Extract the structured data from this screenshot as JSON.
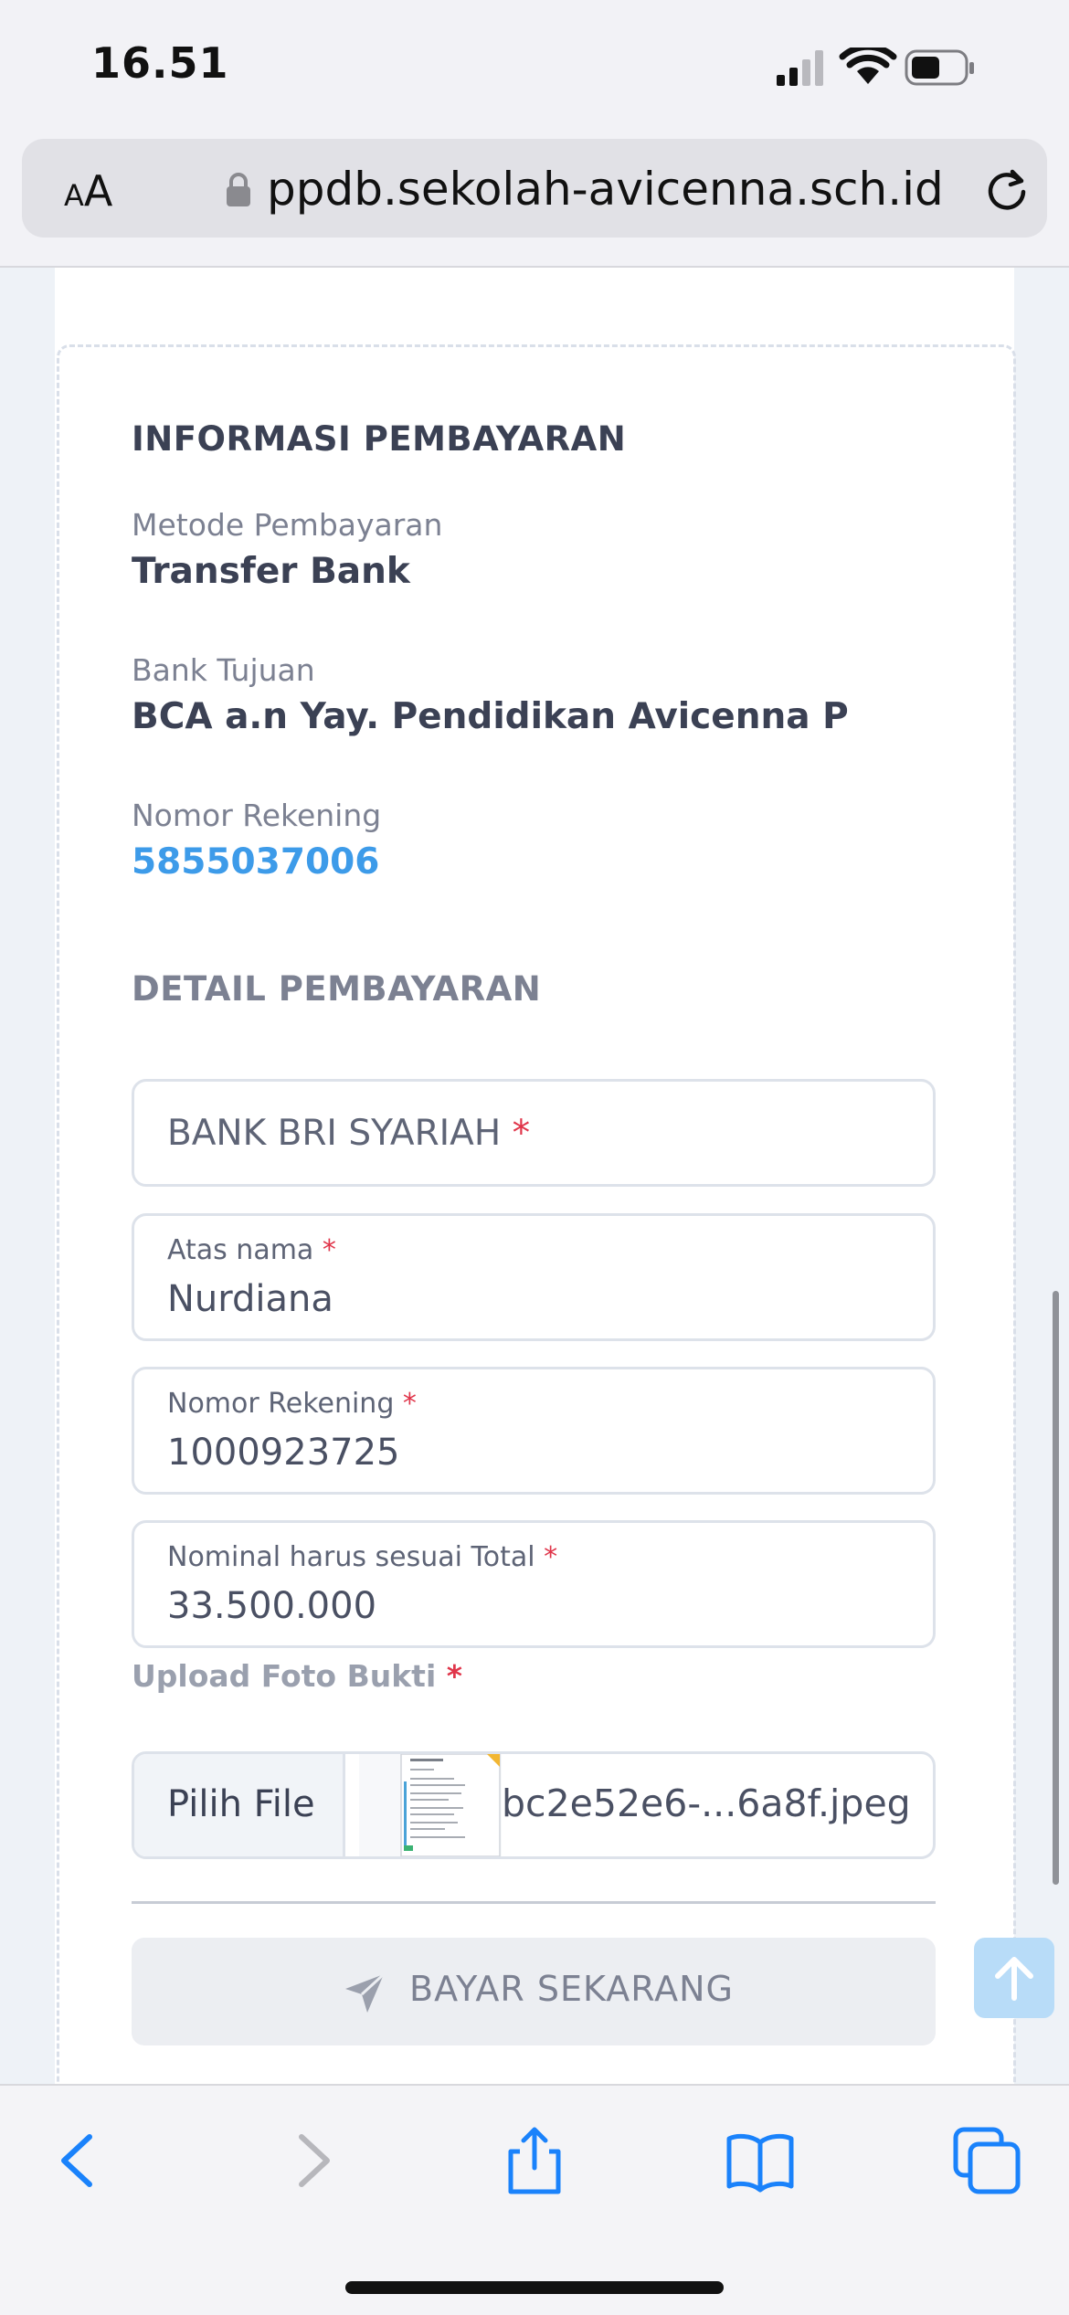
{
  "status_bar": {
    "time": "16.51"
  },
  "browser": {
    "text_size_label_small": "A",
    "text_size_label_large": "A",
    "url": "ppdb.sekolah-avicenna.sch.id"
  },
  "info": {
    "title": "INFORMASI PEMBAYARAN",
    "method_label": "Metode Pembayaran",
    "method_value": "Transfer Bank",
    "bank_label": "Bank Tujuan",
    "bank_value": "BCA a.n Yay. Pendidikan Avicenna P",
    "account_label": "Nomor Rekening",
    "account_value": "5855037006"
  },
  "detail": {
    "title": "DETAIL PEMBAYARAN",
    "bank_select": "BANK BRI SYARIAH",
    "name_label": "Atas nama",
    "name_value": "Nurdiana",
    "account_label": "Nomor Rekening",
    "account_value": "1000923725",
    "amount_label": "Nominal harus sesuai Total",
    "amount_value": "33.500.000",
    "required_mark": "*",
    "upload_label": "Upload Foto Bukti",
    "choose_file": "Pilih File",
    "file_name": "bc2e52e6-...6a8f.jpeg",
    "pay_button": "BAYAR SEKARANG"
  },
  "colors": {
    "accent_link": "#3d9be9",
    "required": "#e0354a",
    "ios_blue": "#1a82fb"
  },
  "icons": [
    "lock-icon",
    "reload-icon",
    "send-icon",
    "arrow-up-icon",
    "back-icon",
    "forward-icon",
    "share-icon",
    "bookmarks-icon",
    "tabs-icon"
  ]
}
